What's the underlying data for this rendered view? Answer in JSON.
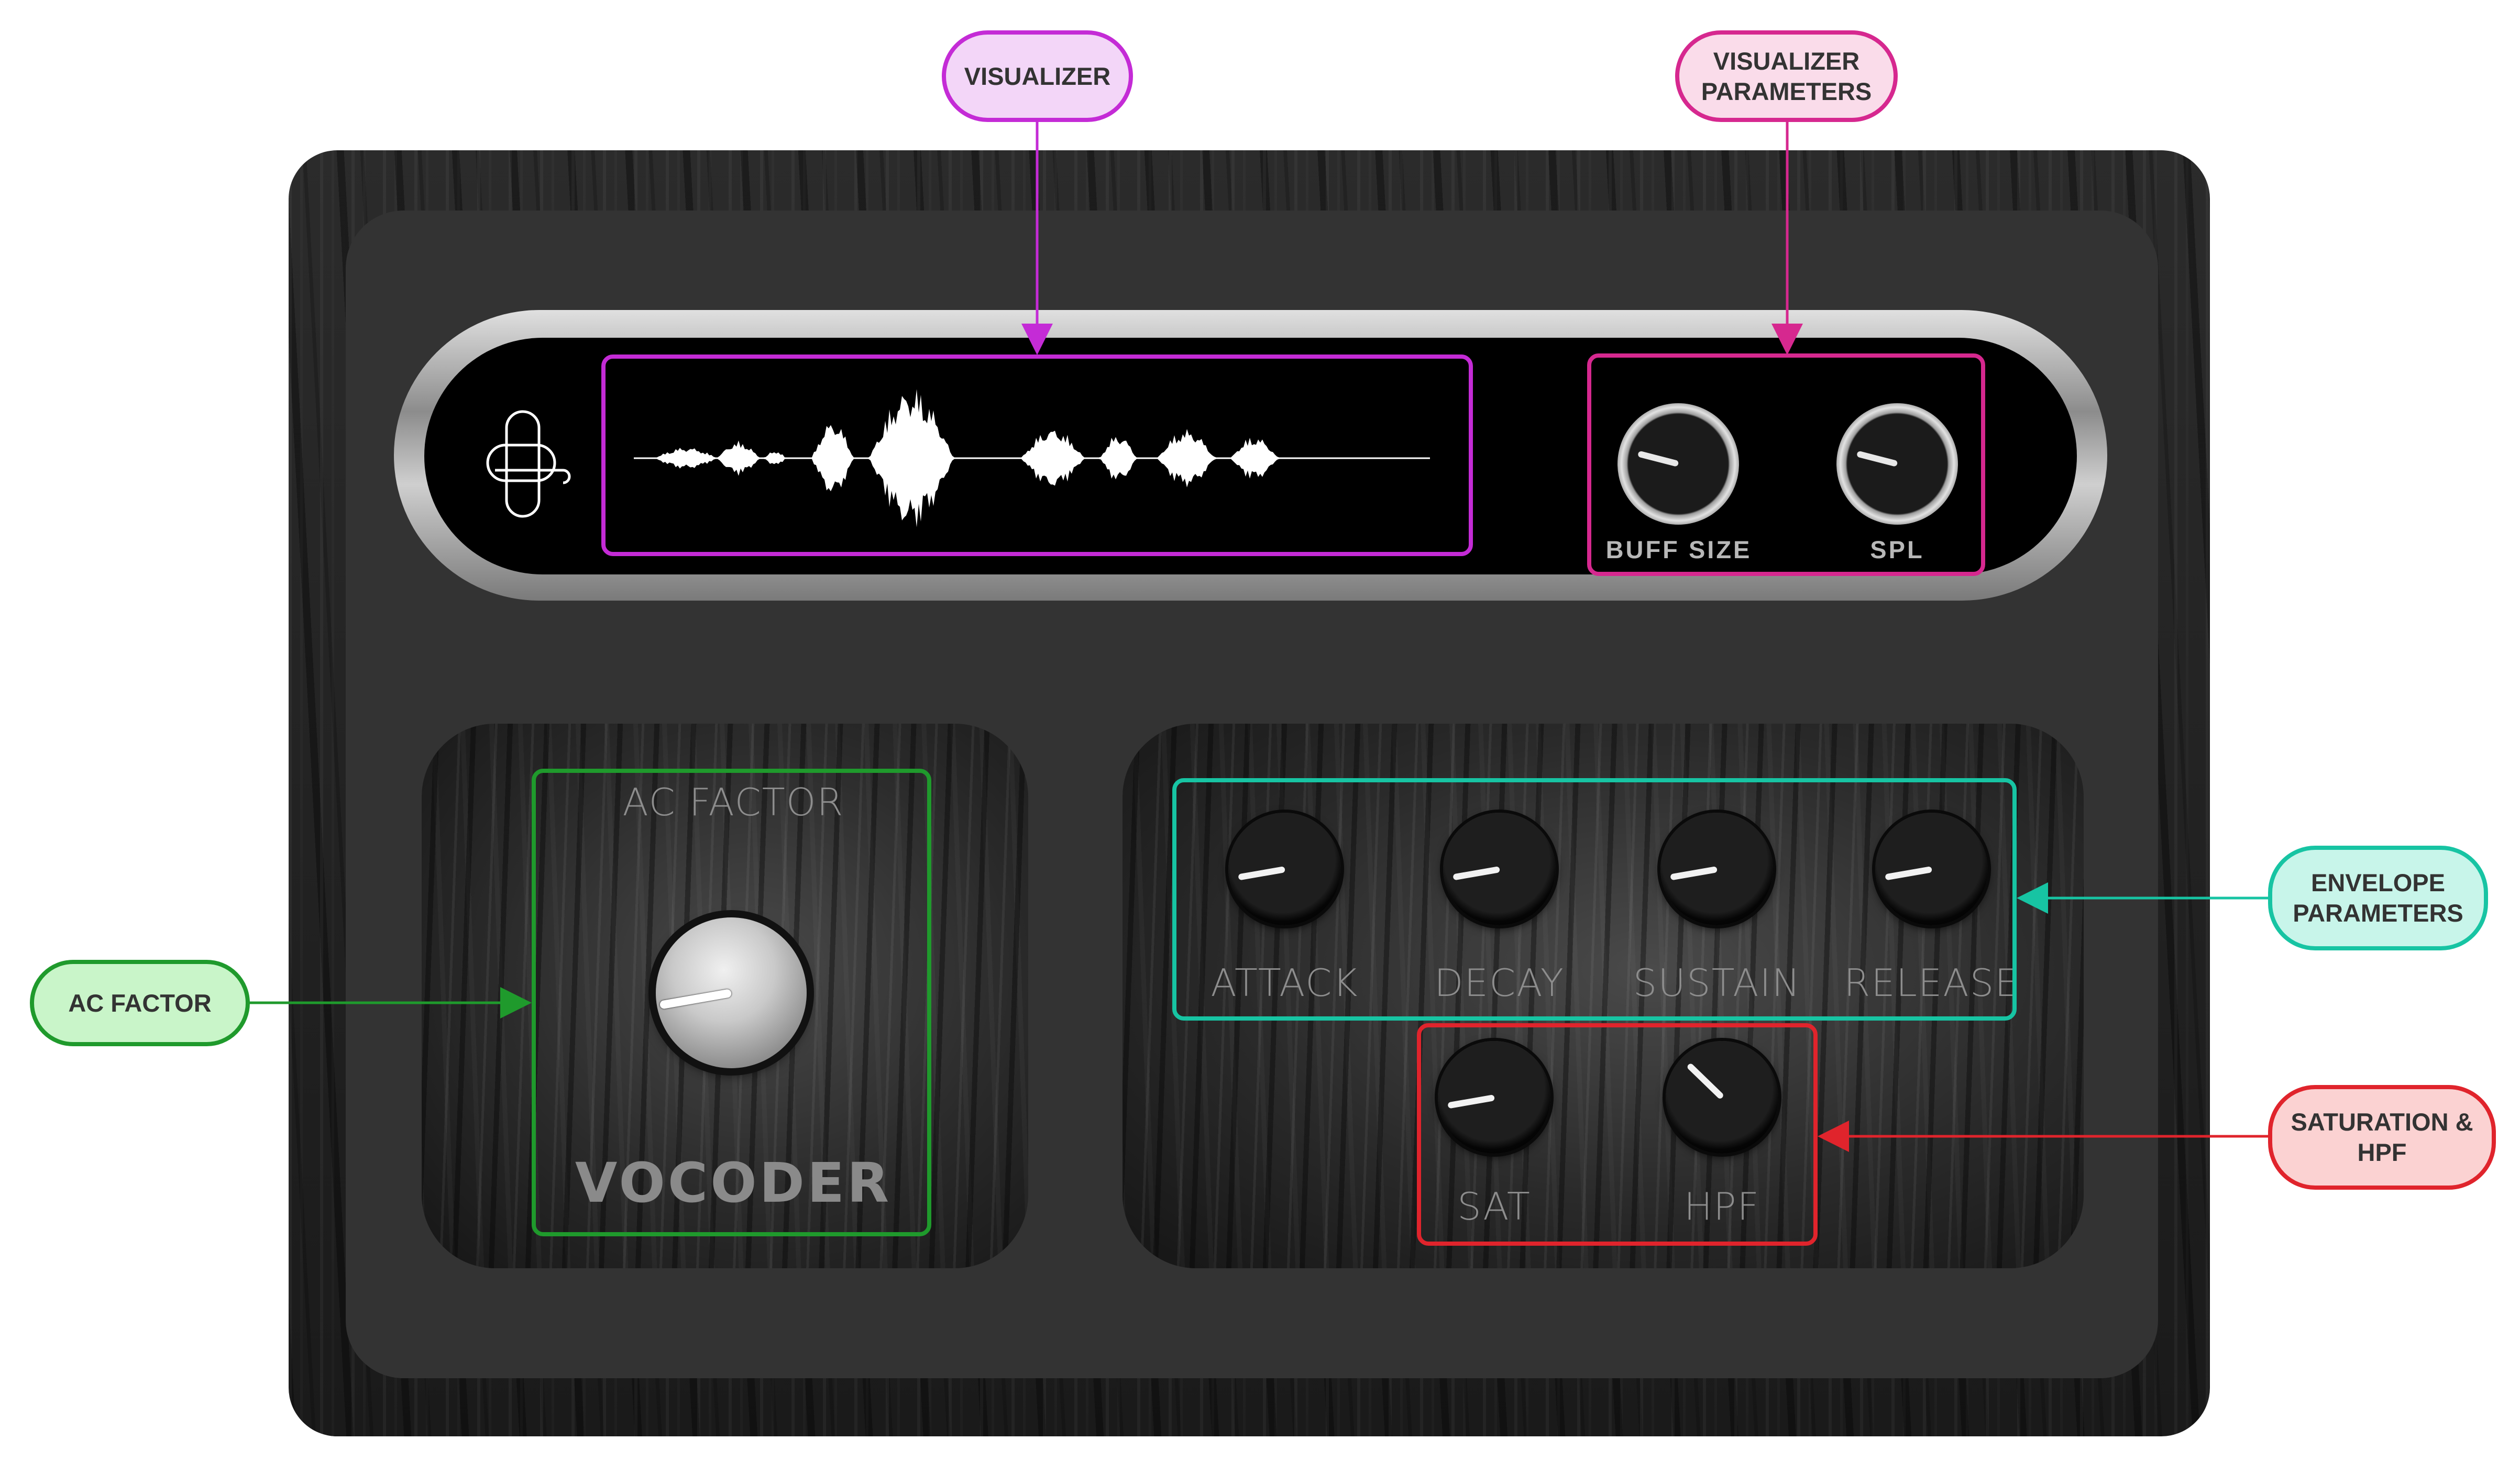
{
  "plugin": {
    "visualizer_knobs": [
      {
        "label": "BUFF SIZE",
        "value_fraction": 0.22
      },
      {
        "label": "SPL",
        "value_fraction": 0.22
      }
    ],
    "ac_factor": {
      "label": "AC FACTOR",
      "value_fraction": 0.13
    },
    "product_name": "VOCODER",
    "envelope_knobs": [
      {
        "label": "ATTACK",
        "value_fraction": 0.13
      },
      {
        "label": "DECAY",
        "value_fraction": 0.13
      },
      {
        "label": "SUSTAIN",
        "value_fraction": 0.13
      },
      {
        "label": "RELEASE",
        "value_fraction": 0.13
      }
    ],
    "sat_hpf_knobs": [
      {
        "label": "SAT",
        "value_fraction": 0.13
      },
      {
        "label": "HPF",
        "value_fraction": 0.33
      }
    ]
  },
  "annotations": {
    "visualizer": {
      "lines": [
        "VISUALIZER"
      ],
      "color": "#c42bd6",
      "fill": "#f3d6f8"
    },
    "visualizer_parameters": {
      "lines": [
        "VISUALIZER",
        "PARAMETERS"
      ],
      "color": "#d6288f",
      "fill": "#fadcea"
    },
    "ac_factor": {
      "lines": [
        "AC FACTOR"
      ],
      "color": "#1f9a2c",
      "fill": "#c9f5c9"
    },
    "envelope_parameters": {
      "lines": [
        "ENVELOPE",
        "PARAMETERS"
      ],
      "color": "#17c4a3",
      "fill": "#c8f5ea"
    },
    "saturation_hpf": {
      "lines": [
        "SATURATION &",
        "HPF"
      ],
      "color": "#e0242c",
      "fill": "#fbd2d2"
    }
  },
  "icons": [
    "plugin-logo-icon",
    "waveform-icon"
  ]
}
